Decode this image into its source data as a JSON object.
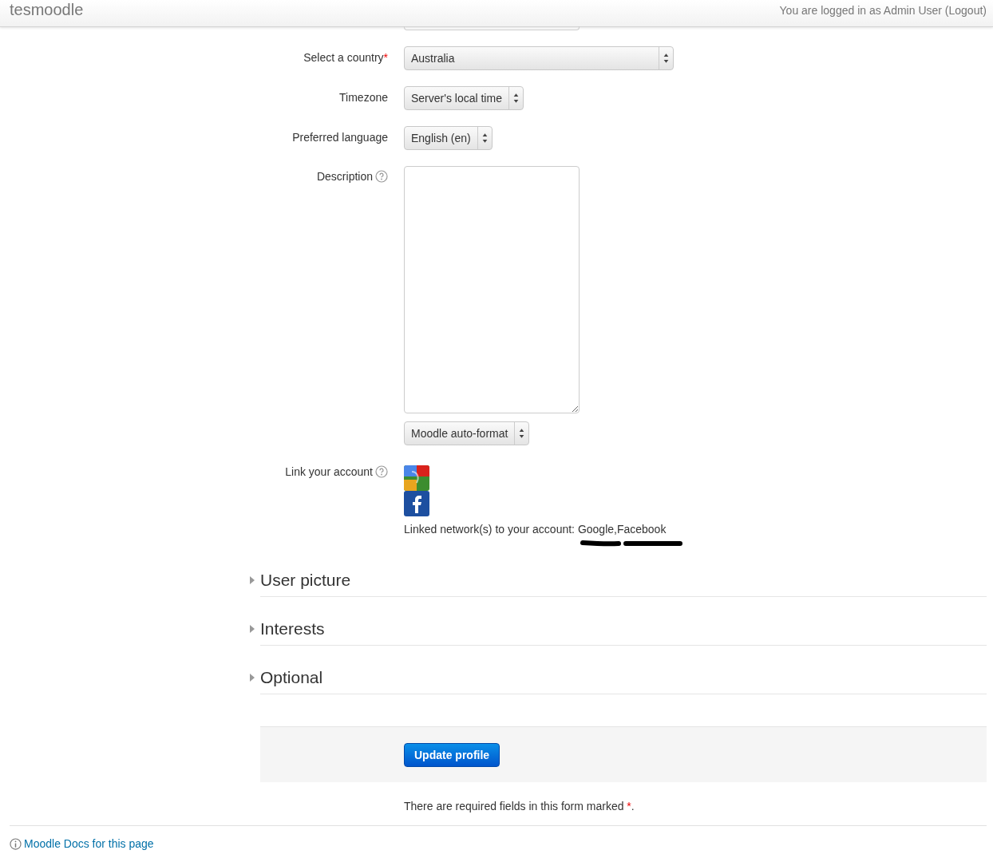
{
  "header": {
    "site_name": "tesmoodle",
    "login_info": "You are logged in as Admin User (Logout)"
  },
  "fields": [
    {
      "kind": "wide-select",
      "label": "Select a country",
      "required": true,
      "help": false,
      "value": "Australia"
    },
    {
      "kind": "select",
      "label": "Timezone",
      "required": false,
      "help": false,
      "value": "Server's local time"
    },
    {
      "kind": "select",
      "label": "Preferred language",
      "required": false,
      "help": false,
      "value": "English (en)"
    },
    {
      "kind": "textarea",
      "label": "Description",
      "required": false,
      "help": true,
      "format": "Moodle auto-format"
    },
    {
      "kind": "networks",
      "label": "Link your account",
      "required": false,
      "help": true,
      "networks": [
        {
          "kind": "google"
        },
        {
          "kind": "facebook"
        }
      ],
      "linked_text": "Linked network(s) to your account: Google,Facebook"
    }
  ],
  "sections": [
    {
      "title": "User picture",
      "expanded": false
    },
    {
      "title": "Interests",
      "expanded": false
    },
    {
      "title": "Optional",
      "expanded": false
    }
  ],
  "submit_button": "Update profile",
  "required_note": {
    "text": "There are required fields in this form marked ",
    "mark": "*",
    "end": "."
  },
  "footer_link": "Moodle Docs for this page"
}
